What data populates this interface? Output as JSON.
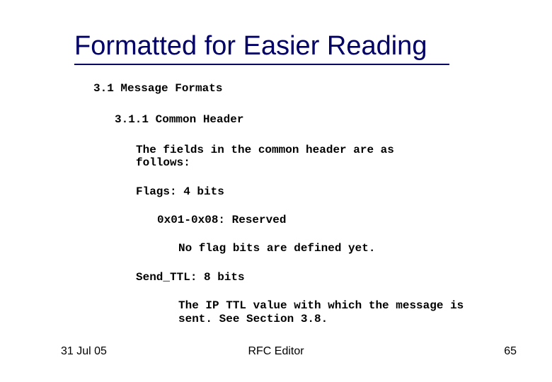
{
  "title": "Formatted for Easier Reading",
  "content": {
    "sec31": "3.1 Message Formats",
    "sec311": "3.1.1 Common Header",
    "fields_intro_l1": "The fields in the common header are as",
    "fields_intro_l2": "follows:",
    "flags": "Flags: 4 bits",
    "reserved": "0x01-0x08: Reserved",
    "noflag": "No flag bits are defined yet.",
    "sendttl": "Send_TTL: 8 bits",
    "ttl_l1": "The IP TTL value with which the message is",
    "ttl_l2": "sent. See Section 3.8."
  },
  "footer": {
    "date": "31 Jul 05",
    "center": "RFC Editor",
    "page": "65"
  }
}
